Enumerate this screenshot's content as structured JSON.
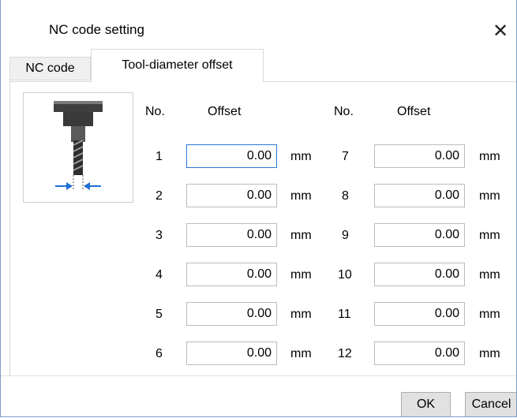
{
  "window": {
    "title": "NC code setting"
  },
  "tabs": [
    {
      "label": "NC code",
      "active": false
    },
    {
      "label": "Tool-diameter offset",
      "active": true
    }
  ],
  "headers": {
    "no": "No.",
    "offset": "Offset"
  },
  "rows": [
    {
      "no": "1",
      "value": "0.00",
      "unit": "mm"
    },
    {
      "no": "2",
      "value": "0.00",
      "unit": "mm"
    },
    {
      "no": "3",
      "value": "0.00",
      "unit": "mm"
    },
    {
      "no": "4",
      "value": "0.00",
      "unit": "mm"
    },
    {
      "no": "5",
      "value": "0.00",
      "unit": "mm"
    },
    {
      "no": "6",
      "value": "0.00",
      "unit": "mm"
    },
    {
      "no": "7",
      "value": "0.00",
      "unit": "mm"
    },
    {
      "no": "8",
      "value": "0.00",
      "unit": "mm"
    },
    {
      "no": "9",
      "value": "0.00",
      "unit": "mm"
    },
    {
      "no": "10",
      "value": "0.00",
      "unit": "mm"
    },
    {
      "no": "11",
      "value": "0.00",
      "unit": "mm"
    },
    {
      "no": "12",
      "value": "0.00",
      "unit": "mm"
    }
  ],
  "buttons": {
    "ok": "OK",
    "cancel": "Cancel"
  },
  "icons": {
    "close": "close-icon",
    "diagram": "tool-diameter-diagram-icon"
  },
  "colors": {
    "focus_border": "#2a7ad5",
    "arrow": "#1f6fd1"
  }
}
